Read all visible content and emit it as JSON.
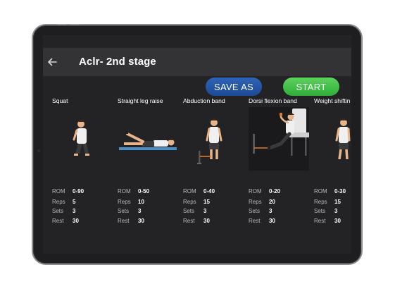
{
  "header": {
    "title": "Aclr- 2nd stage",
    "back_icon": "arrow-left-icon"
  },
  "actions": {
    "save_as_label": "SAVE AS",
    "start_label": "START"
  },
  "stat_labels": {
    "rom": "ROM",
    "reps": "Reps",
    "sets": "Sets",
    "rest": "Rest"
  },
  "exercises": [
    {
      "name": "Squat",
      "rom": "0-90",
      "reps": "5",
      "sets": "3",
      "rest": "30"
    },
    {
      "name": "Straight leg raise",
      "rom": "0-50",
      "reps": "10",
      "sets": "3",
      "rest": "30"
    },
    {
      "name": "Abduction band",
      "rom": "0-40",
      "reps": "15",
      "sets": "3",
      "rest": "30"
    },
    {
      "name": "Dorsi flexion band",
      "rom": "0-20",
      "reps": "20",
      "sets": "3",
      "rest": "30"
    },
    {
      "name": "Weight shiftin",
      "rom": "0-30",
      "reps": "15",
      "sets": "3",
      "rest": "30"
    }
  ],
  "colors": {
    "save_as": "#1c4a95",
    "start": "#2fae3a",
    "screen_bg": "#232325",
    "appbar_bg": "#333336"
  }
}
